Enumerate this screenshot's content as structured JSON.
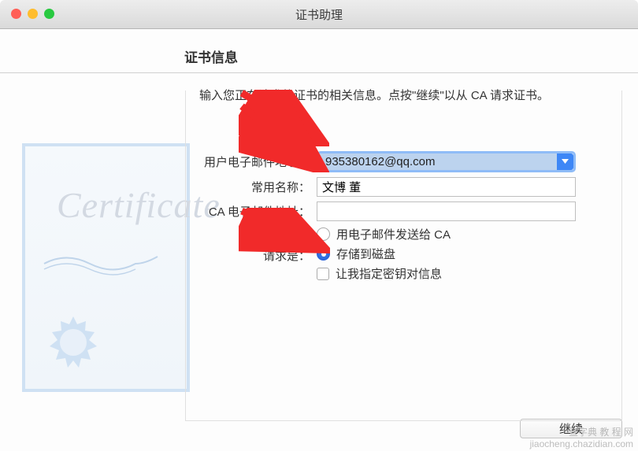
{
  "window": {
    "title": "证书助理"
  },
  "section": {
    "heading": "证书信息",
    "instruction": "输入您正在请求的证书的相关信息。点按\"继续\"以从 CA 请求证书。"
  },
  "form": {
    "email_label": "用户电子邮件地址：",
    "email_value": "935380162@qq.com",
    "name_label": "常用名称：",
    "name_value": "文博 董",
    "ca_email_label": "CA 电子邮件地址：",
    "ca_email_value": "",
    "request_label": "请求是：",
    "option_email_ca": "用电子邮件发送给 CA",
    "option_save_disk": "存储到磁盘",
    "checkbox_keypair": "让我指定密钥对信息"
  },
  "footer": {
    "continue": "继续"
  },
  "decorative": {
    "cert_text": "Certificate"
  },
  "watermark": "查字典 教 程 网\njiaocheng.chazidian.com",
  "colors": {
    "accent": "#3e87f6",
    "arrow": "#f12a2a"
  }
}
